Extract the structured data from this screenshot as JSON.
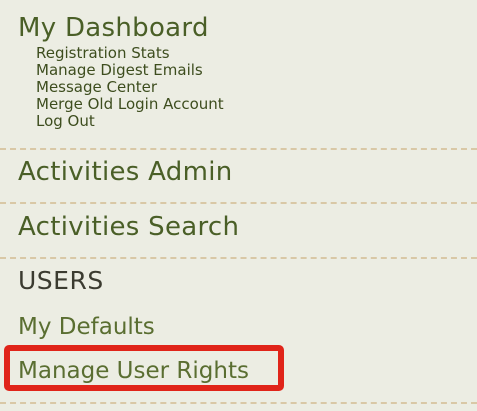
{
  "dashboard": {
    "title": "My Dashboard",
    "links": [
      {
        "label": "Registration Stats"
      },
      {
        "label": "Manage Digest Emails"
      },
      {
        "label": "Message Center"
      },
      {
        "label": "Merge Old Login Account"
      },
      {
        "label": "Log Out"
      }
    ]
  },
  "nav": {
    "activities_admin": "Activities Admin",
    "activities_search": "Activities Search"
  },
  "users": {
    "heading": "USERS",
    "links": [
      {
        "label": "My Defaults"
      },
      {
        "label": "Manage User Rights"
      }
    ]
  },
  "colors": {
    "panel_background": "#ecede3",
    "link_green": "#4a5f27",
    "divider": "#d9c8a6",
    "highlight_red": "#e02419"
  }
}
